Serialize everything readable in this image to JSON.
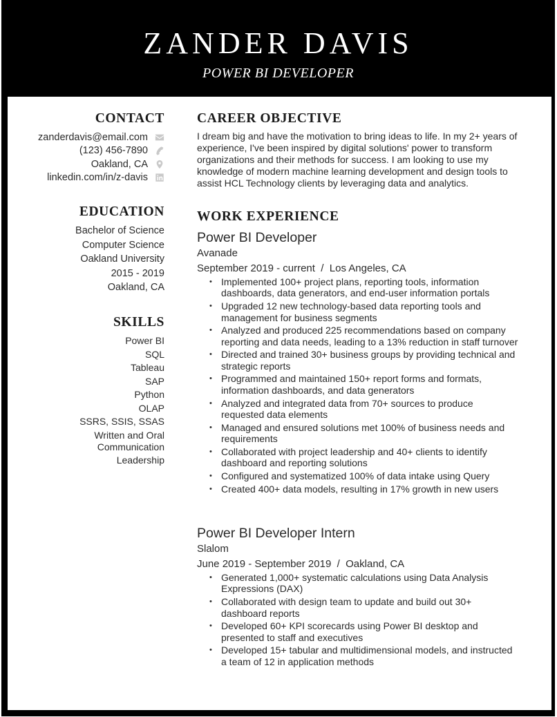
{
  "header": {
    "name": "ZANDER DAVIS",
    "title": "POWER BI DEVELOPER"
  },
  "contact": {
    "heading": "CONTACT",
    "items": [
      {
        "text": "zanderdavis@email.com",
        "icon": "envelope-icon"
      },
      {
        "text": "(123) 456-7890",
        "icon": "phone-icon"
      },
      {
        "text": "Oakland, CA",
        "icon": "map-pin-icon"
      },
      {
        "text": "linkedin.com/in/z-davis",
        "icon": "linkedin-icon"
      }
    ]
  },
  "education": {
    "heading": "EDUCATION",
    "lines": [
      "Bachelor of Science",
      "Computer Science",
      "Oakland University",
      "2015 - 2019",
      "Oakland, CA"
    ]
  },
  "skills": {
    "heading": "SKILLS",
    "items": [
      "Power BI",
      "SQL",
      "Tableau",
      "SAP",
      "Python",
      "OLAP",
      "SSRS, SSIS, SSAS",
      "Written and Oral Communication",
      "Leadership"
    ]
  },
  "objective": {
    "heading": "CAREER OBJECTIVE",
    "text": "I dream big and have the motivation to bring ideas to life. In my 2+ years of experience, I've been inspired by digital solutions' power to transform organizations and their methods for success. I am looking to use my knowledge of modern machine learning development and design tools to assist HCL Technology clients by leveraging data and analytics."
  },
  "work": {
    "heading": "WORK EXPERIENCE",
    "jobs": [
      {
        "title": "Power BI Developer",
        "company": "Avanade",
        "meta": "September 2019 - current  /  Los Angeles, CA",
        "bullets": [
          "Implemented 100+ project plans, reporting tools, information dashboards, data generators, and end-user information portals",
          "Upgraded 12 new technology-based data reporting tools and management for business segments",
          "Analyzed and produced 225 recommendations based on company reporting and data needs, leading to a 13% reduction in staff turnover",
          "Directed and trained 30+ business groups by providing technical and strategic reports",
          "Programmed and maintained 150+ report forms and formats, information dashboards, and data generators",
          "Analyzed and integrated data from 70+ sources to produce requested data elements",
          "Managed and ensured solutions met 100% of business needs and requirements",
          "Collaborated with project leadership and 40+ clients to identify dashboard and reporting solutions",
          "Configured and systematized 100% of data intake using Query",
          "Created 400+ data models, resulting in 17% growth in new users"
        ]
      },
      {
        "title": "Power BI Developer Intern",
        "company": "Slalom",
        "meta": "June 2019 - September 2019  /  Oakland, CA",
        "bullets": [
          "Generated 1,000+ systematic calculations using Data Analysis Expressions (DAX)",
          "Collaborated with design team to update and build out 30+ dashboard reports",
          "Developed 60+ KPI scorecards using Power BI desktop and presented to staff and executives",
          "Developed 15+ tabular and multidimensional models, and instructed a team of 12 in application methods"
        ]
      }
    ]
  }
}
